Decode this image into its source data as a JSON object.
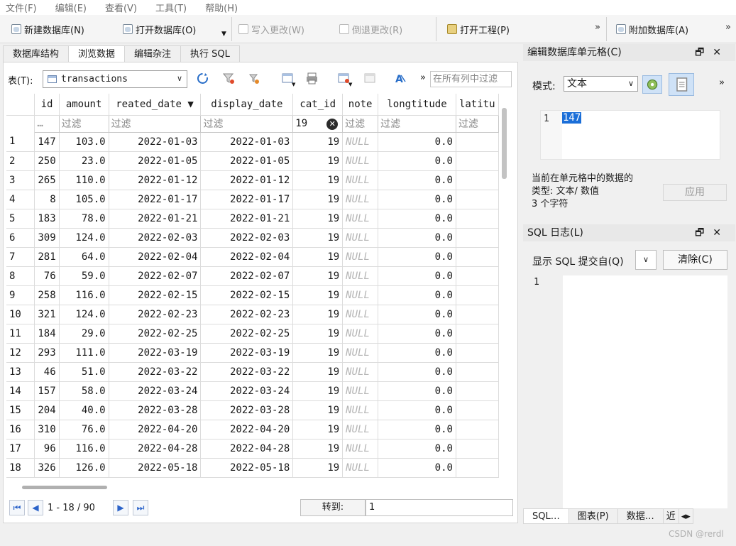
{
  "menu": [
    "文件(F)",
    "编辑(E)",
    "查看(V)",
    "工具(T)",
    "帮助(H)"
  ],
  "toolbar": {
    "new_db": "新建数据库(N)",
    "open_db": "打开数据库(O)",
    "write_changes": "写入更改(W)",
    "revert_changes": "倒退更改(R)",
    "open_project": "打开工程(P)",
    "attach_db": "附加数据库(A)",
    "more": "»"
  },
  "tabs": [
    "数据库结构",
    "浏览数据",
    "编辑杂注",
    "执行 SQL"
  ],
  "browse": {
    "table_label": "表(T):",
    "table_name": "transactions",
    "filter_all_placeholder": "在所有列中过滤",
    "more": "»",
    "columns": [
      "id",
      "amount",
      "reated_date ▼",
      "display_date",
      "cat_id",
      "note",
      "longtitude",
      "latitu"
    ],
    "filters": [
      "…",
      "过滤",
      "过滤",
      "过滤",
      "19",
      "过滤",
      "过滤",
      "过滤"
    ],
    "rows": [
      [
        "1",
        "147",
        "103.0",
        "2022-01-03",
        "2022-01-03",
        "19",
        "NULL",
        "0.0",
        ""
      ],
      [
        "2",
        "250",
        "23.0",
        "2022-01-05",
        "2022-01-05",
        "19",
        "NULL",
        "0.0",
        ""
      ],
      [
        "3",
        "265",
        "110.0",
        "2022-01-12",
        "2022-01-12",
        "19",
        "NULL",
        "0.0",
        ""
      ],
      [
        "4",
        "8",
        "105.0",
        "2022-01-17",
        "2022-01-17",
        "19",
        "NULL",
        "0.0",
        ""
      ],
      [
        "5",
        "183",
        "78.0",
        "2022-01-21",
        "2022-01-21",
        "19",
        "NULL",
        "0.0",
        ""
      ],
      [
        "6",
        "309",
        "124.0",
        "2022-02-03",
        "2022-02-03",
        "19",
        "NULL",
        "0.0",
        ""
      ],
      [
        "7",
        "281",
        "64.0",
        "2022-02-04",
        "2022-02-04",
        "19",
        "NULL",
        "0.0",
        ""
      ],
      [
        "8",
        "76",
        "59.0",
        "2022-02-07",
        "2022-02-07",
        "19",
        "NULL",
        "0.0",
        ""
      ],
      [
        "9",
        "258",
        "116.0",
        "2022-02-15",
        "2022-02-15",
        "19",
        "NULL",
        "0.0",
        ""
      ],
      [
        "10",
        "321",
        "124.0",
        "2022-02-23",
        "2022-02-23",
        "19",
        "NULL",
        "0.0",
        ""
      ],
      [
        "11",
        "184",
        "29.0",
        "2022-02-25",
        "2022-02-25",
        "19",
        "NULL",
        "0.0",
        ""
      ],
      [
        "12",
        "293",
        "111.0",
        "2022-03-19",
        "2022-03-19",
        "19",
        "NULL",
        "0.0",
        ""
      ],
      [
        "13",
        "46",
        "51.0",
        "2022-03-22",
        "2022-03-22",
        "19",
        "NULL",
        "0.0",
        ""
      ],
      [
        "14",
        "157",
        "58.0",
        "2022-03-24",
        "2022-03-24",
        "19",
        "NULL",
        "0.0",
        ""
      ],
      [
        "15",
        "204",
        "40.0",
        "2022-03-28",
        "2022-03-28",
        "19",
        "NULL",
        "0.0",
        ""
      ],
      [
        "16",
        "310",
        "76.0",
        "2022-04-20",
        "2022-04-20",
        "19",
        "NULL",
        "0.0",
        ""
      ],
      [
        "17",
        "96",
        "116.0",
        "2022-04-28",
        "2022-04-28",
        "19",
        "NULL",
        "0.0",
        ""
      ],
      [
        "18",
        "326",
        "126.0",
        "2022-05-18",
        "2022-05-18",
        "19",
        "NULL",
        "0.0",
        ""
      ]
    ],
    "pager": {
      "info": "1 - 18 / 90",
      "goto_label": "转到:",
      "goto_value": "1"
    }
  },
  "edit_cell": {
    "title": "编辑数据库单元格(C)",
    "mode_label": "模式:",
    "mode_value": "文本",
    "more": "»",
    "line_no": "1",
    "value": "147",
    "info_line1": "当前在单元格中的数据的",
    "info_line2": "类型: 文本/ 数值",
    "info_line3": "3 个字符",
    "apply": "应用"
  },
  "sql_log": {
    "title": "SQL 日志(L)",
    "show_label": "显示 SQL 提交自(Q)",
    "clear": "清除(C)",
    "line_no": "1"
  },
  "bottom_tabs": [
    "SQL…",
    "图表(P)",
    "数据…",
    "近"
  ],
  "watermark": "CSDN @rerdl",
  "dock_buttons": "🗗✕"
}
